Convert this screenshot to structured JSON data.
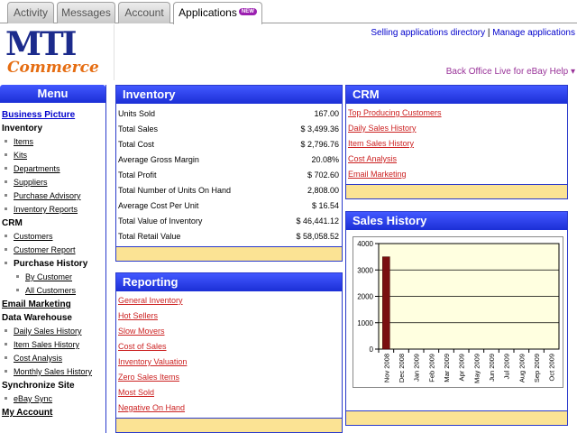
{
  "tabs": [
    {
      "label": "Activity"
    },
    {
      "label": "Messages"
    },
    {
      "label": "Account"
    },
    {
      "label": "Applications",
      "badge": "NEW"
    }
  ],
  "header": {
    "logo_mti": "MTI",
    "logo_commerce": "Commerce",
    "link_selling": "Selling applications directory",
    "link_sep": "|",
    "link_manage": "Manage applications",
    "help_link": "Back Office Live for eBay Help ▾"
  },
  "menu": {
    "title": "Menu",
    "business_picture": "Business Picture",
    "inventory": "Inventory",
    "inventory_items": [
      "Items",
      "Kits",
      "Departments",
      "Suppliers",
      "Purchase Advisory",
      "Inventory Reports"
    ],
    "crm": "CRM",
    "crm_items": [
      "Customers",
      "Customer Report"
    ],
    "purchase_history": "Purchase History",
    "purchase_items": [
      "By Customer",
      "All Customers"
    ],
    "email_marketing": "Email Marketing",
    "data_warehouse": "Data Warehouse",
    "dw_items": [
      "Daily Sales History",
      "Item Sales History",
      "Cost Analysis",
      "Monthly Sales History"
    ],
    "synchronize_site": "Synchronize Site",
    "sync_items": [
      "eBay Sync"
    ],
    "my_account": "My Account"
  },
  "inventory": {
    "title": "Inventory",
    "rows": [
      {
        "label": "Units Sold",
        "value": "167.00"
      },
      {
        "label": "Total Sales",
        "value": "$ 3,499.36"
      },
      {
        "label": "Total Cost",
        "value": "$ 2,796.76"
      },
      {
        "label": "Average Gross Margin",
        "value": "20.08%"
      },
      {
        "label": "Total Profit",
        "value": "$ 702.60"
      },
      {
        "label": "Total Number of Units On Hand",
        "value": "2,808.00"
      },
      {
        "label": "Average Cost Per Unit",
        "value": "$ 16.54"
      },
      {
        "label": "Total Value of Inventory",
        "value": "$ 46,441.12"
      },
      {
        "label": "Total Retail Value",
        "value": "$ 58,058.52"
      }
    ]
  },
  "reporting": {
    "title": "Reporting",
    "links": [
      "General Inventory",
      "Hot Sellers",
      "Slow Movers",
      "Cost of Sales",
      "Inventory Valuation",
      "Zero Sales Items",
      "Most Sold",
      "Negative On Hand"
    ]
  },
  "crm": {
    "title": "CRM",
    "links": [
      "Top Producing Customers",
      "Daily Sales History",
      "Item Sales History",
      "Cost Analysis",
      "Email Marketing"
    ]
  },
  "sales_history": {
    "title": "Sales History"
  },
  "chart_data": {
    "type": "bar",
    "categories": [
      "Nov 2008",
      "Dec 2008",
      "Jan 2009",
      "Feb 2009",
      "Mar 2009",
      "Apr 2009",
      "May 2009",
      "Jun 2009",
      "Jul 2009",
      "Aug 2009",
      "Sep 2009",
      "Oct 2009"
    ],
    "values": [
      3499.36,
      0,
      0,
      0,
      0,
      0,
      0,
      0,
      0,
      0,
      0,
      0
    ],
    "yticks": [
      "0",
      "1000",
      "2000",
      "3000",
      "4000"
    ],
    "ylim": [
      0,
      4000
    ],
    "grid": true,
    "colors": {
      "bar": "#7a1010",
      "plot_bg": "#ffffe0",
      "grid": "#000000"
    }
  }
}
